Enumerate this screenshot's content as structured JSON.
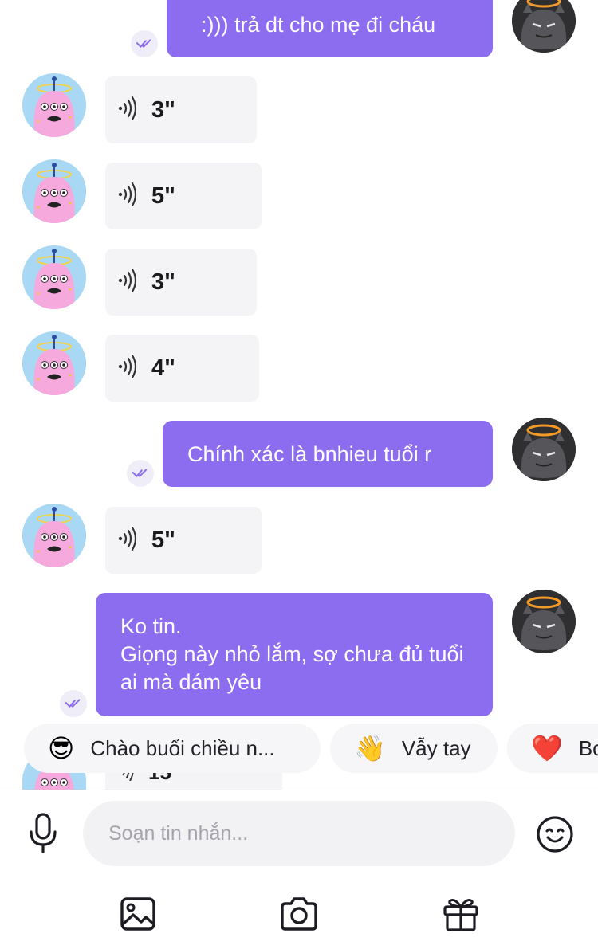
{
  "messages": {
    "out_1": "  :))) trả dt cho mẹ đi cháu",
    "out_2": "Chính xác là bnhieu tuổi r",
    "out_3": "Ko tin.\nGiọng này nhỏ lắm, sợ chưa đủ tuổi ai mà dám yêu",
    "voice_1": "3\"",
    "voice_2": "5\"",
    "voice_3": "3\"",
    "voice_4": "4\"",
    "voice_5": "5\"",
    "voice_partial": "15"
  },
  "suggestions": [
    {
      "icon": "sun-sunglasses-emoji",
      "emoji": "😎",
      "label": "Chào buổi chiều n..."
    },
    {
      "icon": "waving-hand-emoji",
      "emoji": "👋",
      "label": "Vẫy tay"
    },
    {
      "icon": "red-heart-emoji",
      "emoji": "❤️",
      "label": "Bo"
    }
  ],
  "composer": {
    "placeholder": "Soạn tin nhắn..."
  },
  "icons": {
    "mic": "microphone-icon",
    "emoji": "smiley-icon",
    "image": "image-icon",
    "camera": "camera-icon",
    "gift": "gift-icon"
  },
  "colors": {
    "outgoing_bubble": "#8c6cef",
    "incoming_bubble": "#f4f4f6",
    "background": "#ffffff"
  }
}
